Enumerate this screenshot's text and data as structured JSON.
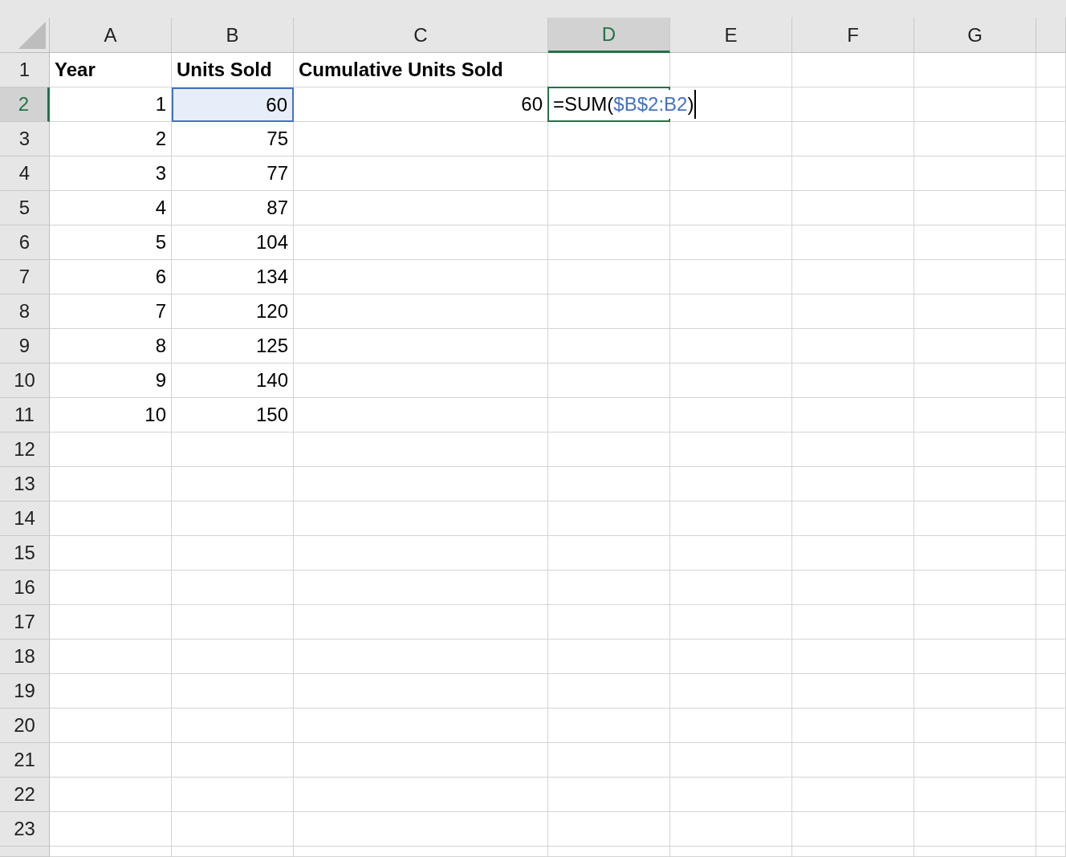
{
  "columns": [
    {
      "label": "A",
      "selected": false
    },
    {
      "label": "B",
      "selected": false
    },
    {
      "label": "C",
      "selected": false
    },
    {
      "label": "D",
      "selected": true
    },
    {
      "label": "E",
      "selected": false
    },
    {
      "label": "F",
      "selected": false
    },
    {
      "label": "G",
      "selected": false
    }
  ],
  "rows": [
    {
      "number": "1",
      "selected": false,
      "cells": [
        {
          "text": "Year",
          "bold": true
        },
        {
          "text": "Units Sold",
          "bold": true
        },
        {
          "text": "Cumulative Units Sold",
          "bold": true
        }
      ]
    },
    {
      "number": "2",
      "selected": true,
      "cells": [
        {
          "text": "1"
        },
        {
          "text": "60",
          "referenced": true
        },
        {
          "text": "60"
        },
        {
          "kind": "formula",
          "editing": true,
          "parts": [
            {
              "kind": "text",
              "text": "=SUM("
            },
            {
              "kind": "reference",
              "text": "$B$2:B2"
            },
            {
              "kind": "text",
              "text": ")"
            }
          ]
        }
      ]
    },
    {
      "number": "3",
      "selected": false,
      "cells": [
        {
          "text": "2"
        },
        {
          "text": "75"
        }
      ]
    },
    {
      "number": "4",
      "selected": false,
      "cells": [
        {
          "text": "3"
        },
        {
          "text": "77"
        }
      ]
    },
    {
      "number": "5",
      "selected": false,
      "cells": [
        {
          "text": "4"
        },
        {
          "text": "87"
        }
      ]
    },
    {
      "number": "6",
      "selected": false,
      "cells": [
        {
          "text": "5"
        },
        {
          "text": "104"
        }
      ]
    },
    {
      "number": "7",
      "selected": false,
      "cells": [
        {
          "text": "6"
        },
        {
          "text": "134"
        }
      ]
    },
    {
      "number": "8",
      "selected": false,
      "cells": [
        {
          "text": "7"
        },
        {
          "text": "120"
        }
      ]
    },
    {
      "number": "9",
      "selected": false,
      "cells": [
        {
          "text": "8"
        },
        {
          "text": "125"
        }
      ]
    },
    {
      "number": "10",
      "selected": false,
      "cells": [
        {
          "text": "9"
        },
        {
          "text": "140"
        }
      ]
    },
    {
      "number": "11",
      "selected": false,
      "cells": [
        {
          "text": "10"
        },
        {
          "text": "150"
        }
      ]
    },
    {
      "number": "12",
      "selected": false,
      "cells": []
    },
    {
      "number": "13",
      "selected": false,
      "cells": []
    },
    {
      "number": "14",
      "selected": false,
      "cells": []
    },
    {
      "number": "15",
      "selected": false,
      "cells": []
    },
    {
      "number": "16",
      "selected": false,
      "cells": []
    },
    {
      "number": "17",
      "selected": false,
      "cells": []
    },
    {
      "number": "18",
      "selected": false,
      "cells": []
    },
    {
      "number": "19",
      "selected": false,
      "cells": []
    },
    {
      "number": "20",
      "selected": false,
      "cells": []
    },
    {
      "number": "21",
      "selected": false,
      "cells": []
    },
    {
      "number": "22",
      "selected": false,
      "cells": []
    },
    {
      "number": "23",
      "selected": false,
      "cells": []
    }
  ]
}
